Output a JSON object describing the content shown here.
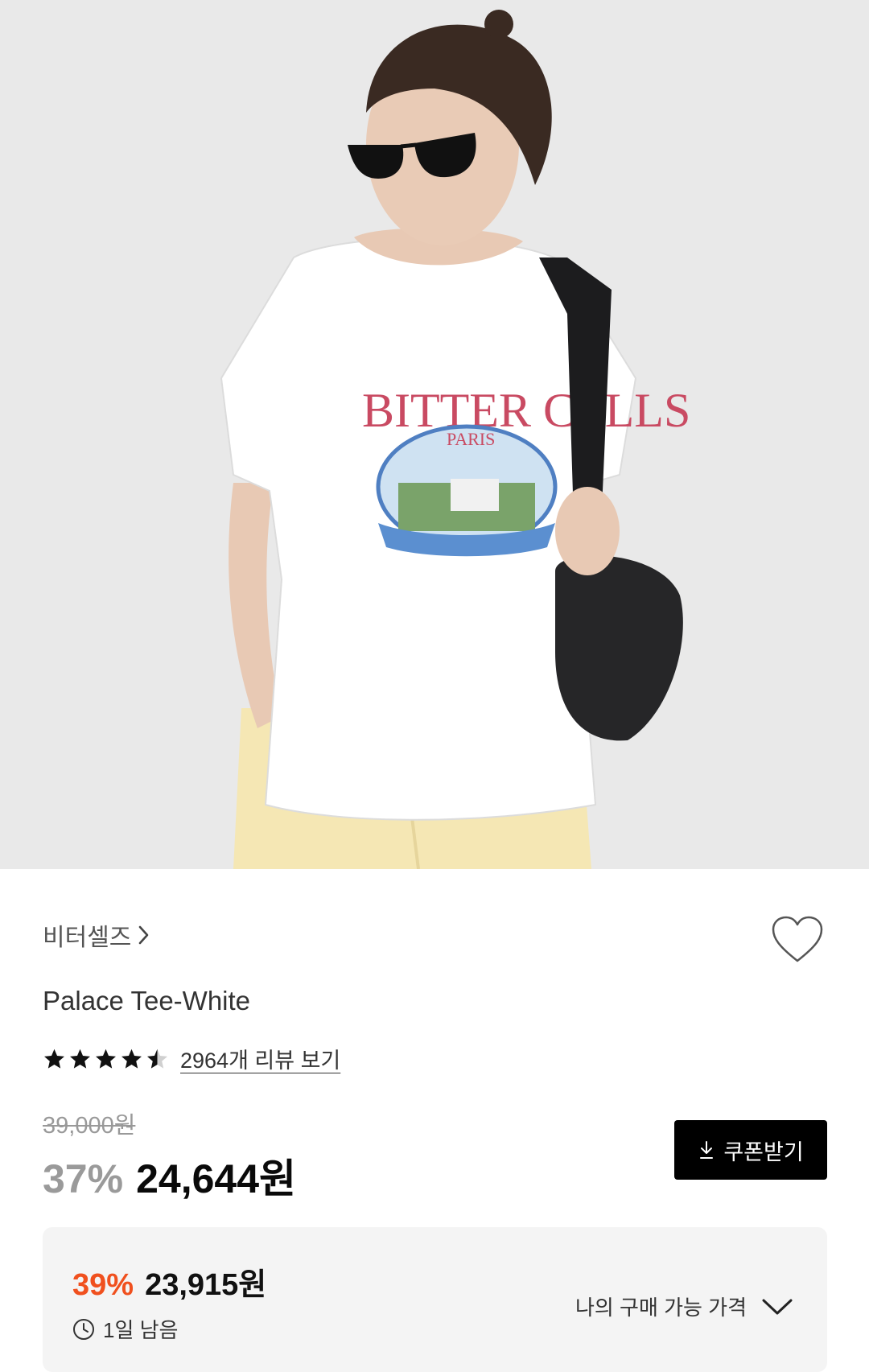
{
  "product_image": {
    "alt": "",
    "print_text": {
      "brand_line": "BITTER CELLS",
      "city": "PARIS"
    }
  },
  "brand": {
    "name": "비터셀즈"
  },
  "product": {
    "title": "Palace Tee-White",
    "rating": 4.5,
    "rating_max": 5,
    "review_link": "2964개 리뷰 보기"
  },
  "price": {
    "original": "39,000원",
    "discount": "37%",
    "sale": "24,644원",
    "coupon_button": "쿠폰받기"
  },
  "my_price": {
    "discount": "39%",
    "price": "23,915원",
    "timer": "1일 남음",
    "toggle_label": "나의 구매 가능 가격"
  },
  "colors": {
    "accent_discount": "#f0501e",
    "button_bg": "#000000",
    "muted_discount": "#9a9a9a",
    "panel_bg": "#f4f4f4"
  },
  "icons": [
    "chevron-right-icon",
    "heart-icon",
    "star-icon",
    "download-icon",
    "clock-icon",
    "chevron-down-icon"
  ]
}
